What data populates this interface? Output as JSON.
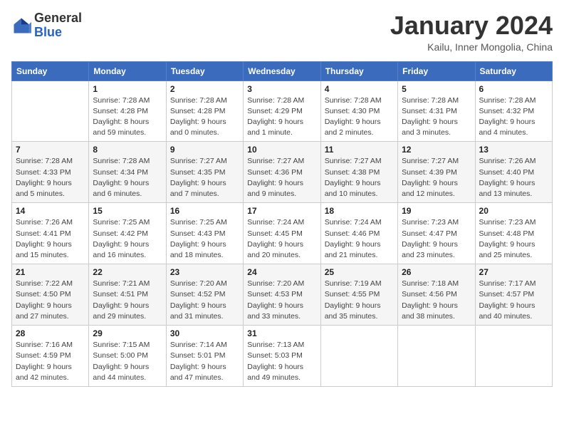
{
  "header": {
    "logo": {
      "general": "General",
      "blue": "Blue"
    },
    "title": "January 2024",
    "location": "Kailu, Inner Mongolia, China"
  },
  "weekdays": [
    "Sunday",
    "Monday",
    "Tuesday",
    "Wednesday",
    "Thursday",
    "Friday",
    "Saturday"
  ],
  "weeks": [
    [
      {
        "day": null
      },
      {
        "day": 1,
        "sunrise": "7:28 AM",
        "sunset": "4:28 PM",
        "daylight": "8 hours and 59 minutes."
      },
      {
        "day": 2,
        "sunrise": "7:28 AM",
        "sunset": "4:28 PM",
        "daylight": "9 hours and 0 minutes."
      },
      {
        "day": 3,
        "sunrise": "7:28 AM",
        "sunset": "4:29 PM",
        "daylight": "9 hours and 1 minute."
      },
      {
        "day": 4,
        "sunrise": "7:28 AM",
        "sunset": "4:30 PM",
        "daylight": "9 hours and 2 minutes."
      },
      {
        "day": 5,
        "sunrise": "7:28 AM",
        "sunset": "4:31 PM",
        "daylight": "9 hours and 3 minutes."
      },
      {
        "day": 6,
        "sunrise": "7:28 AM",
        "sunset": "4:32 PM",
        "daylight": "9 hours and 4 minutes."
      }
    ],
    [
      {
        "day": 7,
        "sunrise": "7:28 AM",
        "sunset": "4:33 PM",
        "daylight": "9 hours and 5 minutes."
      },
      {
        "day": 8,
        "sunrise": "7:28 AM",
        "sunset": "4:34 PM",
        "daylight": "9 hours and 6 minutes."
      },
      {
        "day": 9,
        "sunrise": "7:27 AM",
        "sunset": "4:35 PM",
        "daylight": "9 hours and 7 minutes."
      },
      {
        "day": 10,
        "sunrise": "7:27 AM",
        "sunset": "4:36 PM",
        "daylight": "9 hours and 9 minutes."
      },
      {
        "day": 11,
        "sunrise": "7:27 AM",
        "sunset": "4:38 PM",
        "daylight": "9 hours and 10 minutes."
      },
      {
        "day": 12,
        "sunrise": "7:27 AM",
        "sunset": "4:39 PM",
        "daylight": "9 hours and 12 minutes."
      },
      {
        "day": 13,
        "sunrise": "7:26 AM",
        "sunset": "4:40 PM",
        "daylight": "9 hours and 13 minutes."
      }
    ],
    [
      {
        "day": 14,
        "sunrise": "7:26 AM",
        "sunset": "4:41 PM",
        "daylight": "9 hours and 15 minutes."
      },
      {
        "day": 15,
        "sunrise": "7:25 AM",
        "sunset": "4:42 PM",
        "daylight": "9 hours and 16 minutes."
      },
      {
        "day": 16,
        "sunrise": "7:25 AM",
        "sunset": "4:43 PM",
        "daylight": "9 hours and 18 minutes."
      },
      {
        "day": 17,
        "sunrise": "7:24 AM",
        "sunset": "4:45 PM",
        "daylight": "9 hours and 20 minutes."
      },
      {
        "day": 18,
        "sunrise": "7:24 AM",
        "sunset": "4:46 PM",
        "daylight": "9 hours and 21 minutes."
      },
      {
        "day": 19,
        "sunrise": "7:23 AM",
        "sunset": "4:47 PM",
        "daylight": "9 hours and 23 minutes."
      },
      {
        "day": 20,
        "sunrise": "7:23 AM",
        "sunset": "4:48 PM",
        "daylight": "9 hours and 25 minutes."
      }
    ],
    [
      {
        "day": 21,
        "sunrise": "7:22 AM",
        "sunset": "4:50 PM",
        "daylight": "9 hours and 27 minutes."
      },
      {
        "day": 22,
        "sunrise": "7:21 AM",
        "sunset": "4:51 PM",
        "daylight": "9 hours and 29 minutes."
      },
      {
        "day": 23,
        "sunrise": "7:20 AM",
        "sunset": "4:52 PM",
        "daylight": "9 hours and 31 minutes."
      },
      {
        "day": 24,
        "sunrise": "7:20 AM",
        "sunset": "4:53 PM",
        "daylight": "9 hours and 33 minutes."
      },
      {
        "day": 25,
        "sunrise": "7:19 AM",
        "sunset": "4:55 PM",
        "daylight": "9 hours and 35 minutes."
      },
      {
        "day": 26,
        "sunrise": "7:18 AM",
        "sunset": "4:56 PM",
        "daylight": "9 hours and 38 minutes."
      },
      {
        "day": 27,
        "sunrise": "7:17 AM",
        "sunset": "4:57 PM",
        "daylight": "9 hours and 40 minutes."
      }
    ],
    [
      {
        "day": 28,
        "sunrise": "7:16 AM",
        "sunset": "4:59 PM",
        "daylight": "9 hours and 42 minutes."
      },
      {
        "day": 29,
        "sunrise": "7:15 AM",
        "sunset": "5:00 PM",
        "daylight": "9 hours and 44 minutes."
      },
      {
        "day": 30,
        "sunrise": "7:14 AM",
        "sunset": "5:01 PM",
        "daylight": "9 hours and 47 minutes."
      },
      {
        "day": 31,
        "sunrise": "7:13 AM",
        "sunset": "5:03 PM",
        "daylight": "9 hours and 49 minutes."
      },
      {
        "day": null
      },
      {
        "day": null
      },
      {
        "day": null
      }
    ]
  ]
}
